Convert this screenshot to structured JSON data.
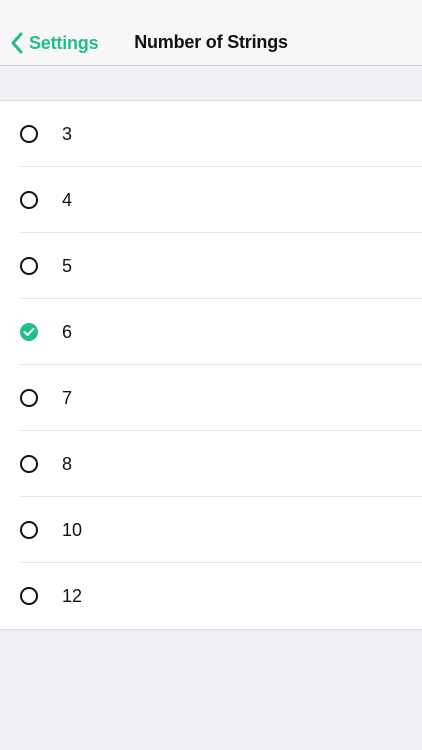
{
  "nav": {
    "back_label": "Settings",
    "title": "Number of Strings",
    "accent_color": "#1fbf87"
  },
  "options": [
    {
      "label": "3",
      "selected": false
    },
    {
      "label": "4",
      "selected": false
    },
    {
      "label": "5",
      "selected": false
    },
    {
      "label": "6",
      "selected": true
    },
    {
      "label": "7",
      "selected": false
    },
    {
      "label": "8",
      "selected": false
    },
    {
      "label": "10",
      "selected": false
    },
    {
      "label": "12",
      "selected": false
    }
  ]
}
